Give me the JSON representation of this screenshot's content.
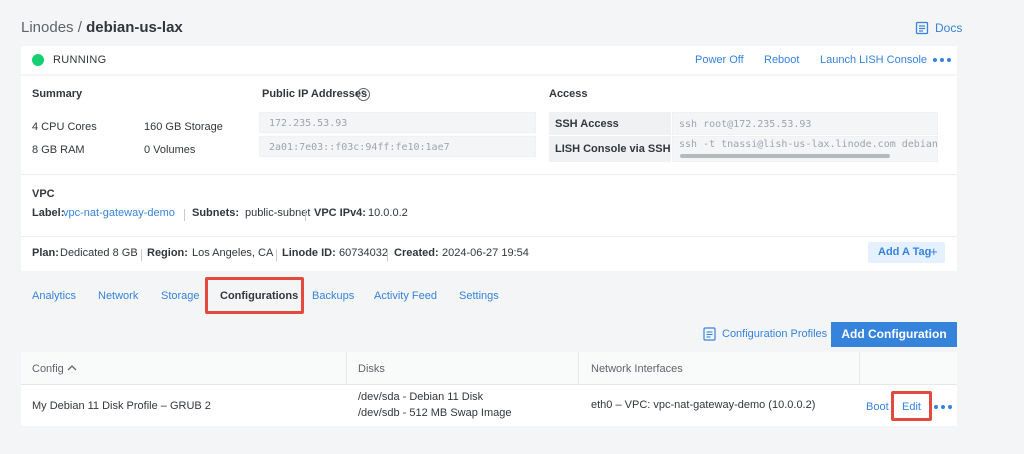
{
  "breadcrumb": {
    "parent": "Linodes",
    "separator": "/",
    "current": "debian-us-lax"
  },
  "docs_label": "Docs",
  "status": {
    "label": "RUNNING",
    "color": "#17cf73"
  },
  "actions": {
    "power_off": "Power Off",
    "reboot": "Reboot",
    "lish": "Launch LISH Console"
  },
  "summary": {
    "title": "Summary",
    "cpu": "4 CPU Cores",
    "storage": "160 GB Storage",
    "ram": "8 GB RAM",
    "volumes": "0 Volumes"
  },
  "ips": {
    "title": "Public IP Addresses",
    "help": "?",
    "ipv4": "172.235.53.93",
    "ipv6": "2a01:7e03::f03c:94ff:fe10:1ae7"
  },
  "access": {
    "title": "Access",
    "ssh_label": "SSH Access",
    "ssh_value": "ssh root@172.235.53.93",
    "lish_label": "LISH Console via SSH",
    "lish_value": "ssh -t tnassi@lish-us-lax.linode.com debian-u"
  },
  "vpc": {
    "title": "VPC",
    "label_key": "Label:",
    "label_value": "vpc-nat-gateway-demo",
    "subnets_key": "Subnets:",
    "subnets_value": "public-subnet",
    "ipv4_key": "VPC IPv4:",
    "ipv4_value": "10.0.0.2"
  },
  "meta": {
    "plan_key": "Plan:",
    "plan_value": "Dedicated 8 GB",
    "region_key": "Region:",
    "region_value": "Los Angeles, CA",
    "id_key": "Linode ID:",
    "id_value": "60734032",
    "created_key": "Created:",
    "created_value": "2024-06-27 19:54",
    "add_tag": "Add A Tag",
    "add_tag_plus": "+"
  },
  "tabs": [
    "Analytics",
    "Network",
    "Storage",
    "Configurations",
    "Backups",
    "Activity Feed",
    "Settings"
  ],
  "config_profiles_label": "Configuration Profiles",
  "add_config_label": "Add Configuration",
  "table": {
    "headers": {
      "config": "Config",
      "disks": "Disks",
      "network": "Network Interfaces"
    },
    "row": {
      "config": "My Debian 11 Disk Profile – GRUB 2",
      "disk1": "/dev/sda - Debian 11 Disk",
      "disk2": "/dev/sdb - 512 MB Swap Image",
      "network": "eth0 – VPC: vpc-nat-gateway-demo (10.0.0.2)",
      "boot": "Boot",
      "edit": "Edit"
    }
  },
  "colors": {
    "accent": "#3683dc",
    "highlight": "#e3493c"
  }
}
